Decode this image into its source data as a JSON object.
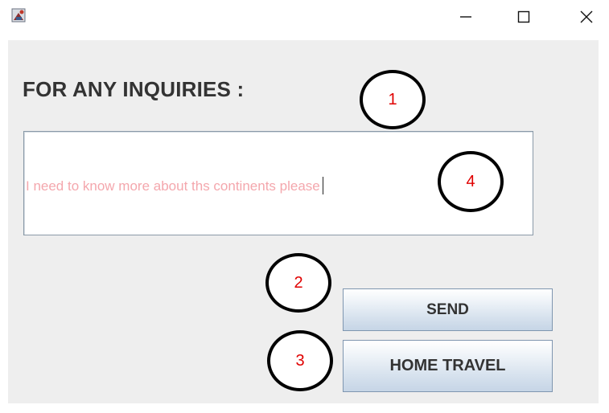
{
  "window": {
    "icon": "java-app-icon",
    "controls": {
      "minimize": "minimize-icon",
      "maximize": "maximize-icon",
      "close": "close-icon"
    }
  },
  "form": {
    "heading": "FOR ANY INQUIRIES :",
    "inquiry_text": "I need to know more about ths continents please",
    "send_label": "SEND",
    "home_label": "HOME TRAVEL"
  },
  "annotations": {
    "marker_1": "1",
    "marker_2": "2",
    "marker_3": "3",
    "marker_4": "4"
  },
  "colors": {
    "content_background": "#eeeeee",
    "inquiry_text": "#f4a7ad",
    "marker_number": "#e00000"
  }
}
